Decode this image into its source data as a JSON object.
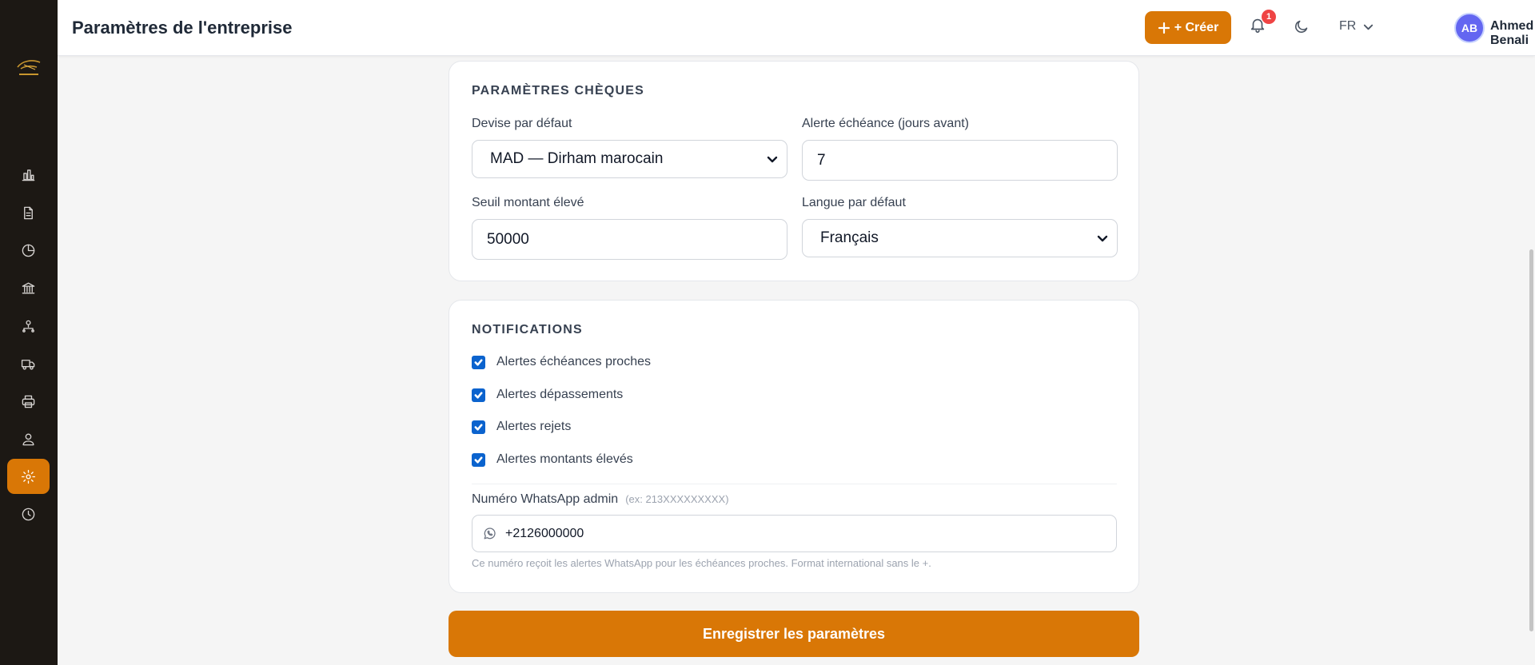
{
  "header": {
    "title": "Paramètres de l'entreprise",
    "create_label": "+ Créer",
    "notification_count": "1",
    "language": "FR",
    "user_initials": "AB",
    "user_name": "Ahmed Benali"
  },
  "sidebar": {
    "items": [
      {
        "name": "dashboard",
        "icon": "bar-chart-icon"
      },
      {
        "name": "documents",
        "icon": "file-icon"
      },
      {
        "name": "reports",
        "icon": "pie-chart-icon"
      },
      {
        "name": "banks",
        "icon": "bank-icon"
      },
      {
        "name": "organization",
        "icon": "network-icon"
      },
      {
        "name": "delivery",
        "icon": "truck-icon"
      },
      {
        "name": "print",
        "icon": "printer-icon"
      },
      {
        "name": "users",
        "icon": "users-icon"
      },
      {
        "name": "settings",
        "icon": "gear-icon",
        "active": true
      },
      {
        "name": "history",
        "icon": "clock-icon"
      }
    ]
  },
  "cheques": {
    "title": "PARAMÈTRES CHÈQUES",
    "currency_label": "Devise par défaut",
    "currency_value": "MAD — Dirham marocain",
    "alert_label": "Alerte échéance (jours avant)",
    "alert_value": "7",
    "threshold_label": "Seuil montant élevé",
    "threshold_value": "50000",
    "language_label": "Langue par défaut",
    "language_value": "Français"
  },
  "notifications": {
    "title": "NOTIFICATIONS",
    "options": [
      {
        "label": "Alertes échéances proches",
        "checked": true
      },
      {
        "label": "Alertes dépassements",
        "checked": true
      },
      {
        "label": "Alertes rejets",
        "checked": true
      },
      {
        "label": "Alertes montants élevés",
        "checked": true
      }
    ],
    "whatsapp_label": "Numéro WhatsApp admin",
    "whatsapp_hint": "(ex: 213XXXXXXXXX)",
    "whatsapp_value": "+2126000000",
    "whatsapp_help": "Ce numéro reçoit les alertes WhatsApp pour les échéances proches. Format international sans le +."
  },
  "save_label": "Enregistrer les paramètres",
  "colors": {
    "accent": "#d97706",
    "sidebar_bg": "#1c1814",
    "checkbox": "#0b63ce",
    "badge": "#ef4444",
    "avatar": "#6366f1"
  }
}
